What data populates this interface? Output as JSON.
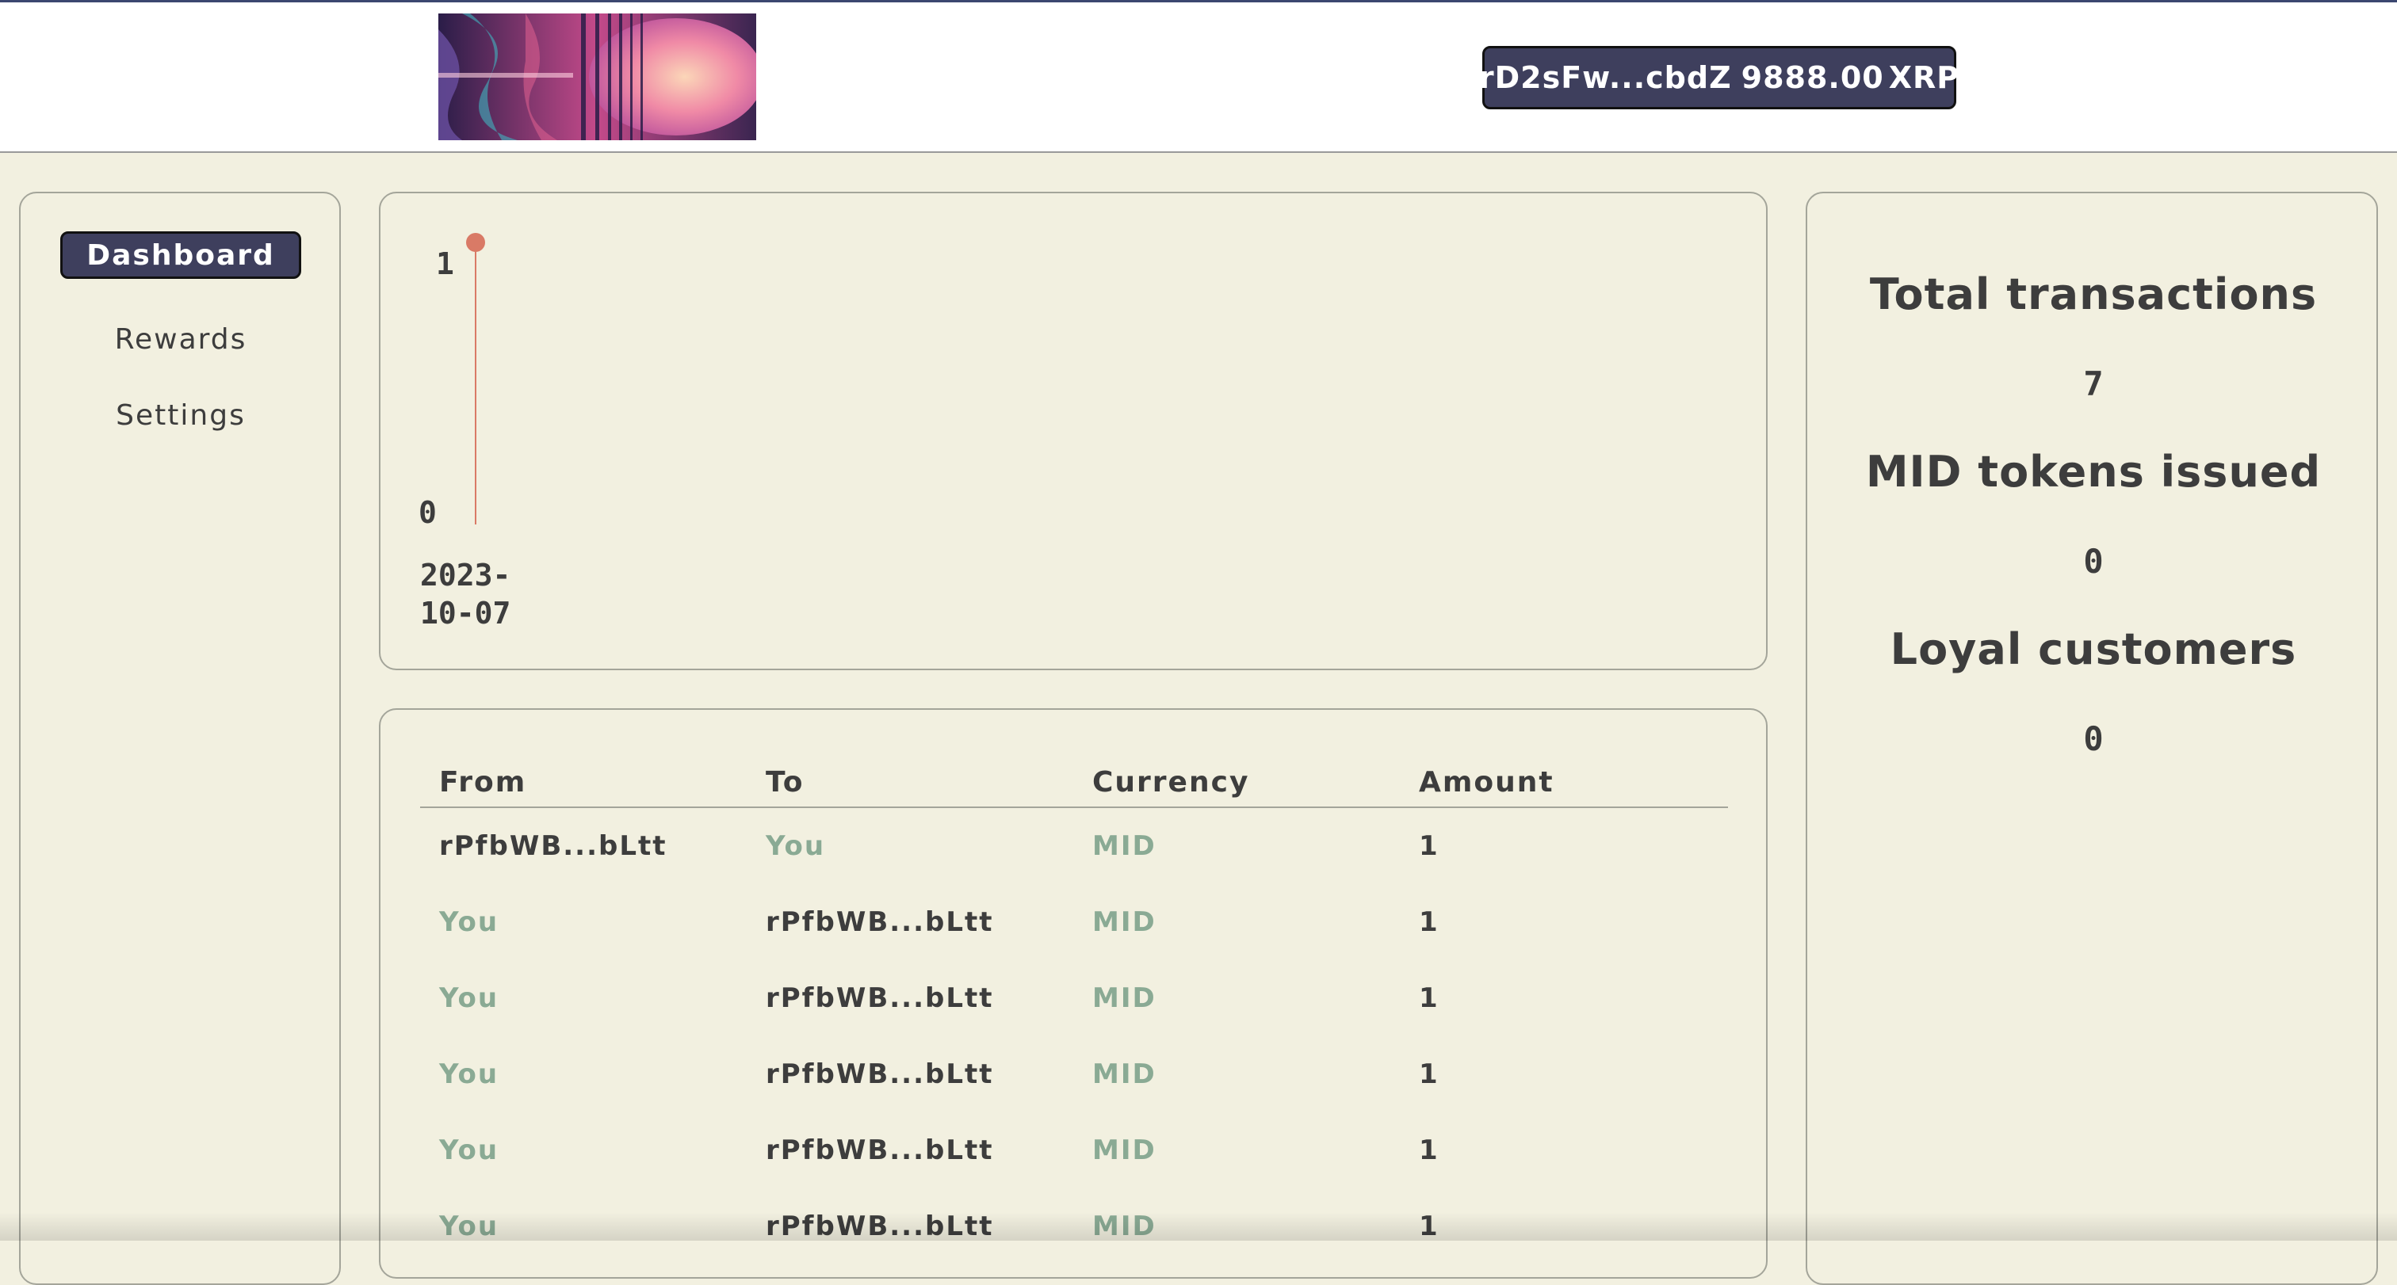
{
  "header": {
    "wallet_address": "rD2sFw...cbdZ",
    "balance": "9888.00",
    "currency": "XRP"
  },
  "sidebar": {
    "items": [
      {
        "label": "Dashboard",
        "active": true
      },
      {
        "label": "Rewards",
        "active": false
      },
      {
        "label": "Settings",
        "active": false
      }
    ]
  },
  "chart_data": {
    "type": "line",
    "x": [
      "2023-10-07"
    ],
    "y_ticks": [
      "1",
      "0"
    ],
    "series": [
      {
        "values": [
          1
        ]
      }
    ],
    "ylim": [
      0,
      1
    ],
    "marker_color": "#d97a66",
    "line_color": "#d97a66"
  },
  "transactions": {
    "columns": [
      "From",
      "To",
      "Currency",
      "Amount"
    ],
    "rows": [
      {
        "from": "rPfbWB...bLtt",
        "to": "You",
        "currency": "MID",
        "amount": "1"
      },
      {
        "from": "You",
        "to": "rPfbWB...bLtt",
        "currency": "MID",
        "amount": "1"
      },
      {
        "from": "You",
        "to": "rPfbWB...bLtt",
        "currency": "MID",
        "amount": "1"
      },
      {
        "from": "You",
        "to": "rPfbWB...bLtt",
        "currency": "MID",
        "amount": "1"
      },
      {
        "from": "You",
        "to": "rPfbWB...bLtt",
        "currency": "MID",
        "amount": "1"
      },
      {
        "from": "You",
        "to": "rPfbWB...bLtt",
        "currency": "MID",
        "amount": "1"
      }
    ]
  },
  "stats": {
    "total_transactions_label": "Total transactions",
    "total_transactions_value": "7",
    "mid_tokens_label": "MID tokens issued",
    "mid_tokens_value": "0",
    "loyal_customers_label": "Loyal customers",
    "loyal_customers_value": "0"
  },
  "colors": {
    "accent": "#3e3f5d",
    "background": "#f2f0e0",
    "highlight_green": "#8aaa94"
  }
}
